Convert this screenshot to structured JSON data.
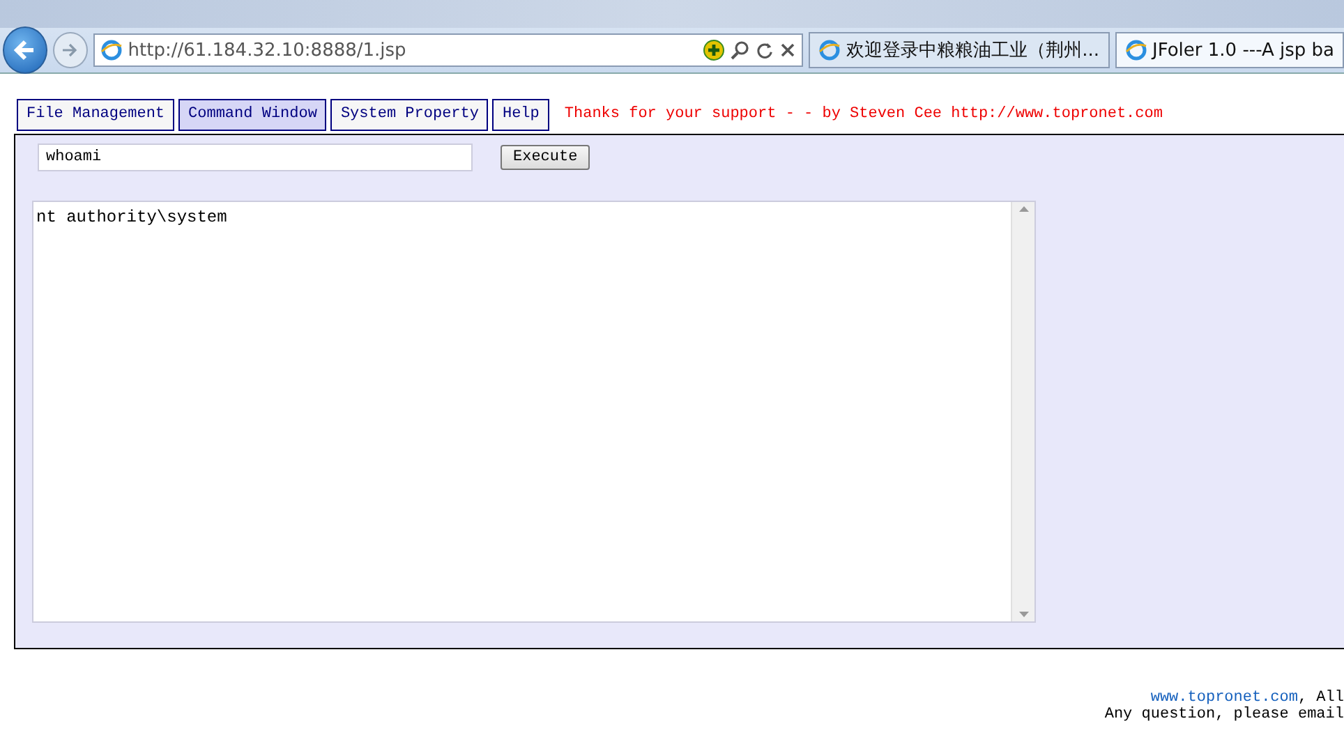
{
  "browser": {
    "address": "http://61.184.32.10:8888/1.jsp",
    "tabs": [
      {
        "title": "欢迎登录中粮粮油工业（荆州...",
        "selected": false
      },
      {
        "title": "JFoler 1.0 ---A jsp ba",
        "selected": true
      }
    ]
  },
  "nav": {
    "tabs": [
      {
        "label": "File Management",
        "selected": false
      },
      {
        "label": "Command Window",
        "selected": true
      },
      {
        "label": "System Property",
        "selected": false
      },
      {
        "label": "Help",
        "selected": false
      }
    ],
    "credit": "Thanks for your support - - by Steven Cee http://www.topronet.com"
  },
  "command": {
    "value": "whoami",
    "button": "Execute",
    "output": "nt authority\\system"
  },
  "footer": {
    "link": "www.topronet.com",
    "line_1_rest": ", All",
    "line_2": "Any question, please email"
  }
}
